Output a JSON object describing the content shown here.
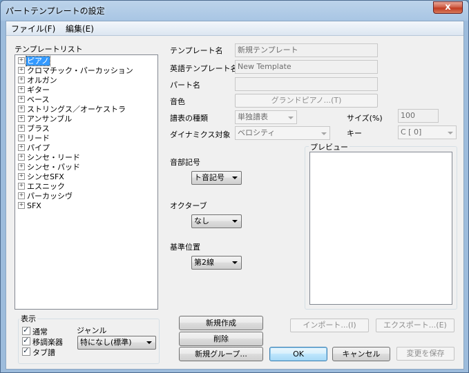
{
  "window": {
    "title": "パートテンプレートの設定",
    "close_label": "x"
  },
  "menu": {
    "file": "ファイル(F)",
    "edit": "編集(E)"
  },
  "template_list": {
    "label": "テンプレートリスト",
    "items": [
      {
        "label": "ピアノ",
        "selected": true
      },
      {
        "label": "クロマチック・パーカッション"
      },
      {
        "label": "オルガン"
      },
      {
        "label": "ギター"
      },
      {
        "label": "ベース"
      },
      {
        "label": "ストリングス／オーケストラ"
      },
      {
        "label": "アンサンブル"
      },
      {
        "label": "ブラス"
      },
      {
        "label": "リード"
      },
      {
        "label": "パイプ"
      },
      {
        "label": "シンセ・リード"
      },
      {
        "label": "シンセ・パッド"
      },
      {
        "label": "シンセSFX"
      },
      {
        "label": "エスニック"
      },
      {
        "label": "パーカッシヴ"
      },
      {
        "label": "SFX"
      }
    ]
  },
  "fields": {
    "template_name_label": "テンプレート名",
    "template_name_value": "新規テンプレート",
    "english_name_label": "英語テンプレート名",
    "english_name_value": "New Template",
    "part_name_label": "パート名",
    "part_name_value": "",
    "tone_label": "音色",
    "tone_button": "グランドピアノ...(T)",
    "score_type_label": "譜表の種類",
    "score_type_value": "単独譜表",
    "size_label": "サイズ(%)",
    "size_value": "100",
    "dynamics_label": "ダイナミクス対象",
    "dynamics_value": "ベロシティ",
    "key_label": "キー",
    "key_value": "C [ 0]"
  },
  "clef": {
    "label": "音部記号",
    "value": "ト音記号"
  },
  "octave": {
    "label": "オクターブ",
    "value": "なし"
  },
  "base_position": {
    "label": "基準位置",
    "value": "第2線"
  },
  "preview": {
    "label": "プレビュー"
  },
  "display": {
    "label": "表示",
    "normal": "通常",
    "transposing": "移調楽器",
    "tab": "タブ譜",
    "genre_label": "ジャンル",
    "genre_value": "特になし(標準)"
  },
  "buttons": {
    "new": "新規作成",
    "delete": "削除",
    "new_group": "新規グループ...",
    "import": "インポート...(I)",
    "export": "エクスポート...(E)",
    "ok": "OK",
    "cancel": "キャンセル",
    "save_changes": "変更を保存"
  }
}
